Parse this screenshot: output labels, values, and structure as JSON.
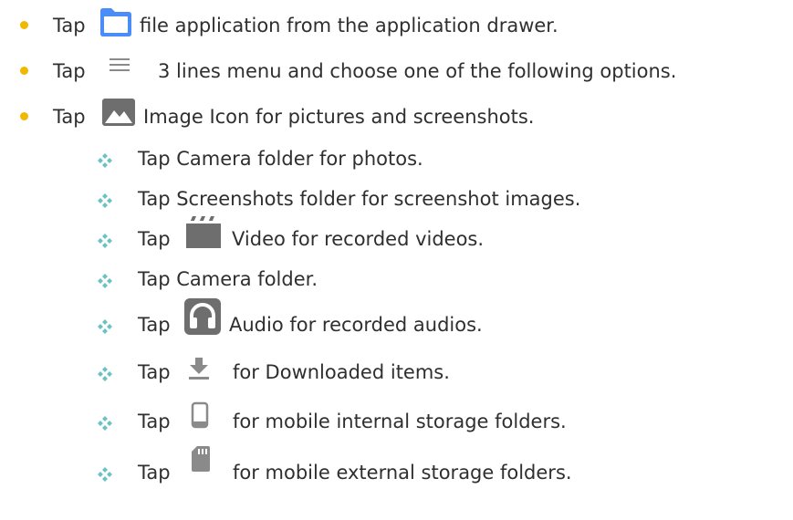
{
  "colors": {
    "bullet": "#f1b800",
    "diamond": "#6cc2c2",
    "folder": "#4a8df8",
    "gray_icon": "#8a8a8a"
  },
  "items": [
    {
      "level": 1,
      "tap": "Tap",
      "icon": "folder-icon",
      "text": "file application from the application drawer."
    },
    {
      "level": 1,
      "tap": "Tap",
      "icon": "menu-lines-icon",
      "text": "3 lines menu and choose one of the following options."
    },
    {
      "level": 1,
      "tap": "Tap",
      "icon": "image-icon",
      "text": "Image Icon for pictures and screenshots."
    },
    {
      "level": 2,
      "text": "Tap Camera folder for photos."
    },
    {
      "level": 2,
      "text": "Tap Screenshots folder for screenshot images."
    },
    {
      "level": 2,
      "tap": "Tap",
      "icon": "video-clapper-icon",
      "text": "Video for recorded videos."
    },
    {
      "level": 2,
      "text": "Tap Camera folder."
    },
    {
      "level": 2,
      "tap": "Tap",
      "icon": "headphones-icon",
      "text": "Audio for recorded audios."
    },
    {
      "level": 2,
      "tap": "Tap",
      "icon": "download-icon",
      "text": "for Downloaded items."
    },
    {
      "level": 2,
      "tap": "Tap",
      "icon": "phone-icon",
      "text": "for mobile internal storage folders."
    },
    {
      "level": 2,
      "tap": "Tap",
      "icon": "sd-card-icon",
      "text": "for mobile external storage folders."
    }
  ]
}
